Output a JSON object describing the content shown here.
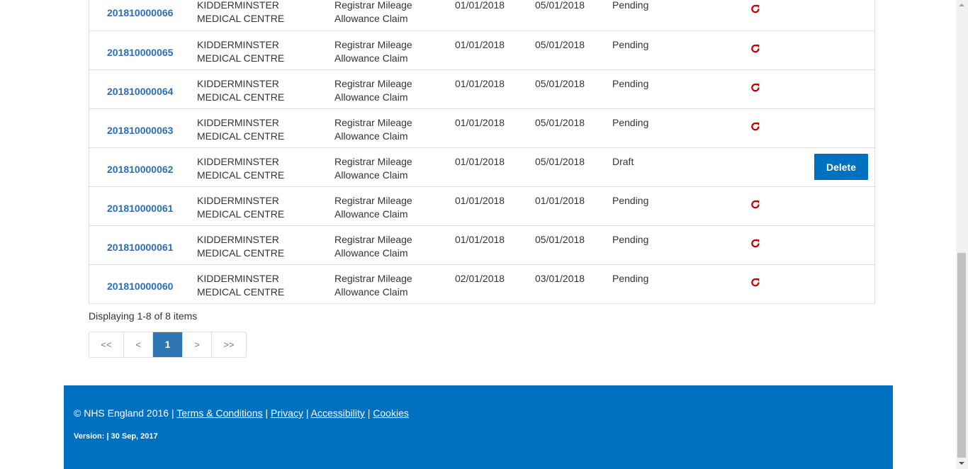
{
  "table": {
    "rows": [
      {
        "ref": "201810000066",
        "practice": "KIDDERMINSTER MEDICAL CENTRE",
        "type": "Registrar Mileage Allowance Claim",
        "from": "01/01/2018",
        "to": "05/01/2018",
        "status": "Pending",
        "action": "resubmit"
      },
      {
        "ref": "201810000065",
        "practice": "KIDDERMINSTER MEDICAL CENTRE",
        "type": "Registrar Mileage Allowance Claim",
        "from": "01/01/2018",
        "to": "05/01/2018",
        "status": "Pending",
        "action": "resubmit"
      },
      {
        "ref": "201810000064",
        "practice": "KIDDERMINSTER MEDICAL CENTRE",
        "type": "Registrar Mileage Allowance Claim",
        "from": "01/01/2018",
        "to": "05/01/2018",
        "status": "Pending",
        "action": "resubmit"
      },
      {
        "ref": "201810000063",
        "practice": "KIDDERMINSTER MEDICAL CENTRE",
        "type": "Registrar Mileage Allowance Claim",
        "from": "01/01/2018",
        "to": "05/01/2018",
        "status": "Pending",
        "action": "resubmit"
      },
      {
        "ref": "201810000062",
        "practice": "KIDDERMINSTER MEDICAL CENTRE",
        "type": "Registrar Mileage Allowance Claim",
        "from": "01/01/2018",
        "to": "05/01/2018",
        "status": "Draft",
        "action": "delete"
      },
      {
        "ref": "201810000061",
        "practice": "KIDDERMINSTER MEDICAL CENTRE",
        "type": "Registrar Mileage Allowance Claim",
        "from": "01/01/2018",
        "to": "01/01/2018",
        "status": "Pending",
        "action": "resubmit"
      },
      {
        "ref": "201810000061",
        "practice": "KIDDERMINSTER MEDICAL CENTRE",
        "type": "Registrar Mileage Allowance Claim",
        "from": "01/01/2018",
        "to": "05/01/2018",
        "status": "Pending",
        "action": "resubmit"
      },
      {
        "ref": "201810000060",
        "practice": "KIDDERMINSTER MEDICAL CENTRE",
        "type": "Registrar Mileage Allowance Claim",
        "from": "02/01/2018",
        "to": "03/01/2018",
        "status": "Pending",
        "action": "resubmit"
      }
    ],
    "delete_label": "Delete",
    "resubmit_icon": "refresh-icon"
  },
  "summary": "Displaying 1-8 of 8 items",
  "pager": {
    "first": "<<",
    "prev": "<",
    "current": "1",
    "next": ">",
    "last": ">>"
  },
  "footer": {
    "copyright": "© NHS England 2016 |",
    "links": [
      "Terms & Conditions",
      "Privacy",
      "Accessibility",
      "Cookies"
    ],
    "separator": "|",
    "version": "Version: | 30 Sep, 2017"
  },
  "colors": {
    "link": "#2a6ebb",
    "icon": "#c00000",
    "button": "#0070c0",
    "pager_active": "#2f76b5",
    "footer_bg": "#0070c0"
  }
}
